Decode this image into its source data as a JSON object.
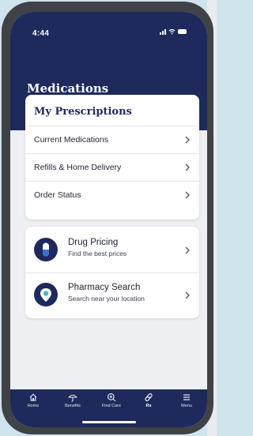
{
  "status_bar": {
    "time": "4:44"
  },
  "header": {
    "title": "Medications"
  },
  "prescriptions": {
    "title": "My Prescriptions",
    "rows": [
      {
        "label": "Current Medications"
      },
      {
        "label": "Refills & Home Delivery"
      },
      {
        "label": "Order Status"
      }
    ]
  },
  "tools": [
    {
      "title": "Drug Pricing",
      "subtitle": "Find the best prices",
      "icon": "pill-icon"
    },
    {
      "title": "Pharmacy Search",
      "subtitle": "Search near your location",
      "icon": "location-pin-icon"
    }
  ],
  "tabbar": {
    "items": [
      {
        "label": "Home",
        "icon": "home-icon"
      },
      {
        "label": "Benefits",
        "icon": "umbrella-icon"
      },
      {
        "label": "Find Care",
        "icon": "search-plus-icon"
      },
      {
        "label": "Rx",
        "icon": "pill-icon",
        "active": true
      },
      {
        "label": "Menu",
        "icon": "hamburger-icon"
      }
    ]
  },
  "colors": {
    "brand_navy": "#1e2a5c",
    "screen_bg": "#eeeff3",
    "pill_blue": "#3b6fd6",
    "pin_teal": "#4fb4c6"
  }
}
